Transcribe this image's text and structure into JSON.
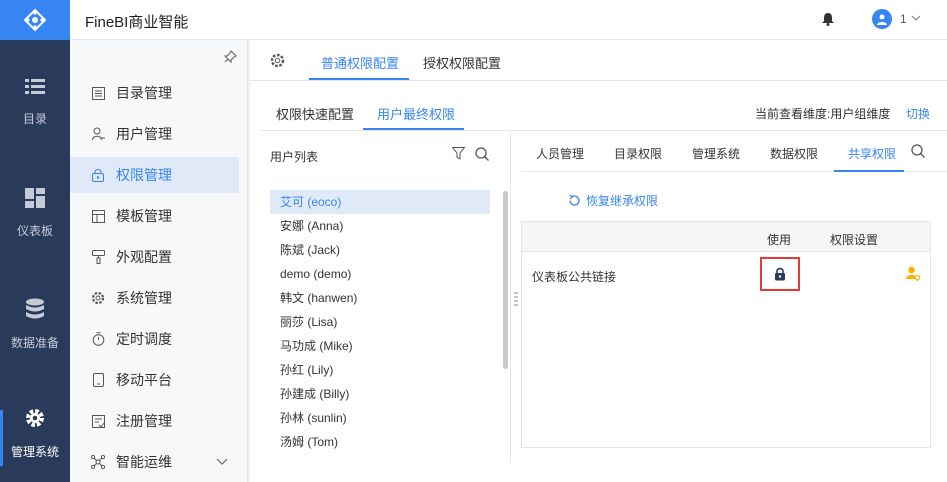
{
  "app": {
    "title": "FineBI商业智能",
    "user": "1"
  },
  "leftnav": [
    {
      "label": "目录",
      "icon": "list-icon"
    },
    {
      "label": "仪表板",
      "icon": "dashboard-icon"
    },
    {
      "label": "数据准备",
      "icon": "database-icon"
    },
    {
      "label": "管理系统",
      "icon": "gear-icon"
    }
  ],
  "submenu": [
    {
      "label": "目录管理"
    },
    {
      "label": "用户管理"
    },
    {
      "label": "权限管理"
    },
    {
      "label": "模板管理"
    },
    {
      "label": "外观配置"
    },
    {
      "label": "系统管理"
    },
    {
      "label": "定时调度"
    },
    {
      "label": "移动平台"
    },
    {
      "label": "注册管理"
    },
    {
      "label": "智能运维"
    }
  ],
  "tabs": {
    "t1": "普通权限配置",
    "t2": "授权权限配置"
  },
  "subtabs": {
    "t1": "权限快速配置",
    "t2": "用户最终权限"
  },
  "view_info": "当前查看维度:用户组维度",
  "switch_label": "切换",
  "userlist": {
    "title": "用户列表",
    "users": [
      "艾可 (eoco)",
      "安娜 (Anna)",
      "陈斌 (Jack)",
      "demo (demo)",
      "韩文 (hanwen)",
      "丽莎 (Lisa)",
      "马功成 (Mike)",
      "孙红 (Lily)",
      "孙建成 (Billy)",
      "孙林 (sunlin)",
      "汤姆 (Tom)"
    ]
  },
  "rtabs": [
    "人员管理",
    "目录权限",
    "管理系统",
    "数据权限",
    "共享权限"
  ],
  "restore_label": "恢复继承权限",
  "table": {
    "col_use": "使用",
    "col_setting": "权限设置",
    "row": "仪表板公共链接"
  },
  "colors": {
    "accent": "#3685f2",
    "nav": "#2a3a5a",
    "highlight": "#e53935"
  }
}
